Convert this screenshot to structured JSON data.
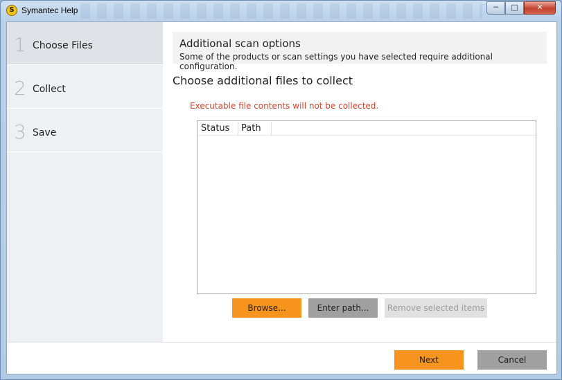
{
  "window": {
    "title": "Symantec Help",
    "icon": "symantec-logo-icon",
    "controls": {
      "minimize": "─",
      "maximize": "□",
      "close": "✕"
    }
  },
  "sidebar": {
    "steps": [
      {
        "number": "1",
        "label": "Choose Files",
        "active": true
      },
      {
        "number": "2",
        "label": "Collect",
        "active": false
      },
      {
        "number": "3",
        "label": "Save",
        "active": false
      }
    ]
  },
  "main": {
    "banner": {
      "title": "Additional scan options",
      "subtitle": "Some of the products or scan settings you have selected require additional configuration."
    },
    "section_title": "Choose additional files to collect",
    "warning": "Executable file contents will not be collected.",
    "list": {
      "columns": [
        "Status",
        "Path"
      ],
      "rows": []
    },
    "buttons": {
      "browse": "Browse...",
      "enter_path": "Enter path...",
      "remove_selected": "Remove selected items"
    }
  },
  "footer": {
    "next": "Next",
    "cancel": "Cancel"
  },
  "colors": {
    "accent": "#f7941d",
    "warning": "#d9432c",
    "secondary_button": "#a0a0a0",
    "disabled_button": "#e1e1e1"
  }
}
